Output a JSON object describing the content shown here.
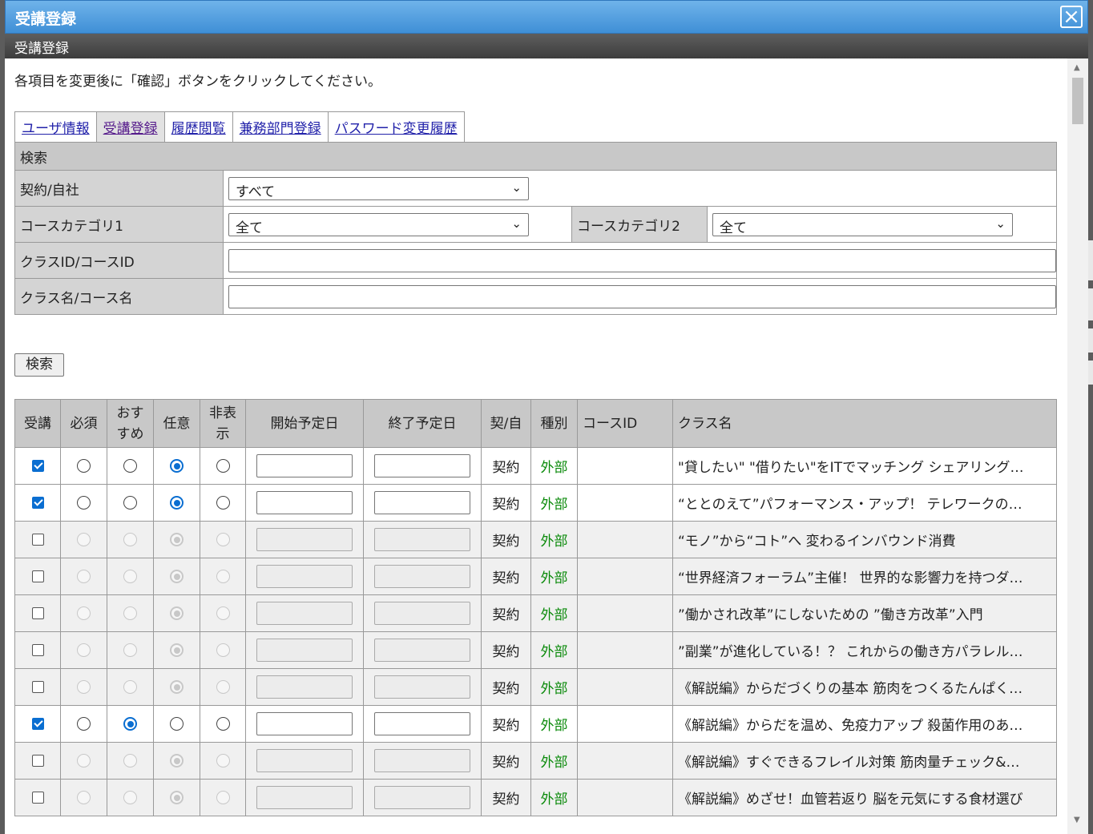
{
  "dialog": {
    "title": "受講登録",
    "close_icon": "close-icon",
    "subtitle": "受講登録",
    "instruction": "各項目を変更後に「確認」ボタンをクリックしてください。"
  },
  "tabs": [
    {
      "label": "ユーザ情報",
      "active": false
    },
    {
      "label": "受講登録",
      "active": true
    },
    {
      "label": "履歴閲覧",
      "active": false
    },
    {
      "label": "兼務部門登録",
      "active": false
    },
    {
      "label": "パスワード変更履歴",
      "active": false
    }
  ],
  "search": {
    "header": "検索",
    "contract_label": "契約/自社",
    "contract_value": "すべて",
    "cat1_label": "コースカテゴリ1",
    "cat1_value": "全て",
    "cat2_label": "コースカテゴリ2",
    "cat2_value": "全て",
    "id_label": "クラスID/コースID",
    "id_value": "",
    "name_label": "クラス名/コース名",
    "name_value": "",
    "button": "検索"
  },
  "list": {
    "headers": {
      "jukou": "受講",
      "hissu": "必須",
      "osusume_1": "おす",
      "osusume_2": "すめ",
      "nini": "任意",
      "hihyouji_1": "非表",
      "hihyouji_2": "示",
      "start": "開始予定日",
      "end": "終了予定日",
      "kei": "契/自",
      "type": "種別",
      "course_id": "コースID",
      "class_name": "クラス名"
    },
    "rows": [
      {
        "enrolled": true,
        "choice": "nini",
        "contract": "契約",
        "kind": "外部",
        "course_id": "",
        "name": "\"貸したい\" \"借りたい\"をITでマッチング シェアリング…"
      },
      {
        "enrolled": true,
        "choice": "nini",
        "contract": "契約",
        "kind": "外部",
        "course_id": "",
        "name": "“ととのえて”パフォーマンス・アップ！ テレワークの…"
      },
      {
        "enrolled": false,
        "choice": "nini",
        "contract": "契約",
        "kind": "外部",
        "course_id": "",
        "name": "“モノ”から“コト”へ 変わるインバウンド消費"
      },
      {
        "enrolled": false,
        "choice": "nini",
        "contract": "契約",
        "kind": "外部",
        "course_id": "",
        "name": "“世界経済フォーラム”主催！ 世界的な影響力を持つダ…"
      },
      {
        "enrolled": false,
        "choice": "nini",
        "contract": "契約",
        "kind": "外部",
        "course_id": "",
        "name": "”働かされ改革”にしないための ”働き方改革”入門"
      },
      {
        "enrolled": false,
        "choice": "nini",
        "contract": "契約",
        "kind": "外部",
        "course_id": "",
        "name": "”副業”が進化している！？ これからの働き方パラレル…"
      },
      {
        "enrolled": false,
        "choice": "nini",
        "contract": "契約",
        "kind": "外部",
        "course_id": "",
        "name": "《解説編》からだづくりの基本 筋肉をつくるたんぱく…"
      },
      {
        "enrolled": true,
        "choice": "osusume",
        "contract": "契約",
        "kind": "外部",
        "course_id": "",
        "name": "《解説編》からだを温め、免疫力アップ 殺菌作用のあ…"
      },
      {
        "enrolled": false,
        "choice": "nini",
        "contract": "契約",
        "kind": "外部",
        "course_id": "",
        "name": "《解説編》すぐできるフレイル対策 筋肉量チェック&…"
      },
      {
        "enrolled": false,
        "choice": "nini",
        "contract": "契約",
        "kind": "外部",
        "course_id": "",
        "name": "《解説編》めざせ！血管若返り 脳を元気にする食材選び"
      }
    ]
  }
}
